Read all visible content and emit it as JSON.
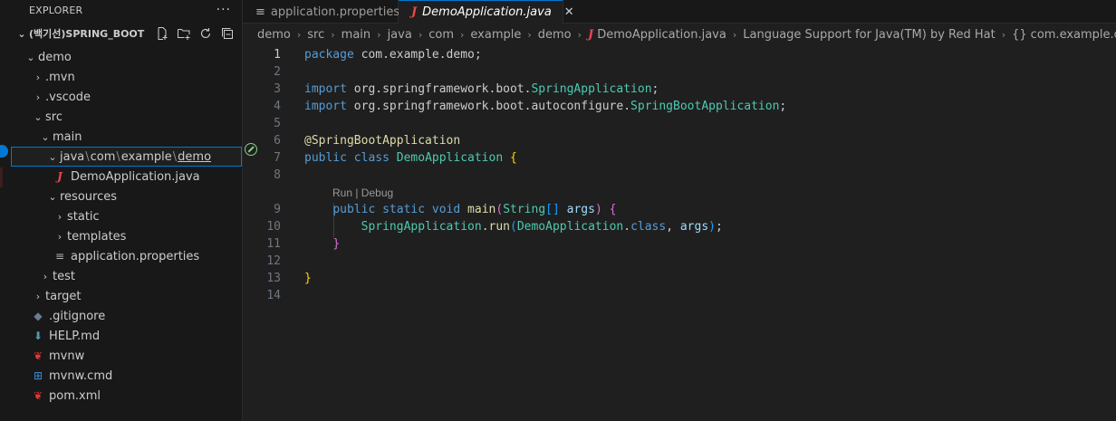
{
  "explorer": {
    "title": "EXPLORER",
    "more": "···",
    "root_label": "(백기선)SPRING_BOOT",
    "actions": [
      "new-file-icon",
      "new-folder-icon",
      "refresh-icon",
      "collapse-all-icon"
    ]
  },
  "tree": {
    "demo": "demo",
    "mvn": ".mvn",
    "vscode": ".vscode",
    "src": "src",
    "main": "main",
    "pkg": {
      "p1": "java",
      "p2": "com",
      "p3": "example",
      "p4": "demo",
      "sep": "\\"
    },
    "demo_app": "DemoApplication.java",
    "resources": "resources",
    "static": "static",
    "templates": "templates",
    "app_props": "application.properties",
    "test": "test",
    "target": "target",
    "gitignore": ".gitignore",
    "help": "HELP.md",
    "mvnw": "mvnw",
    "mvnw_cmd": "mvnw.cmd",
    "pom": "pom.xml"
  },
  "tabs": [
    {
      "label": "application.properties",
      "icon": "properties-file-icon",
      "active": false
    },
    {
      "label": "DemoApplication.java",
      "icon": "java-file-icon",
      "active": true
    }
  ],
  "breadcrumb": {
    "items": [
      "demo",
      "src",
      "main",
      "java",
      "com",
      "example",
      "demo"
    ],
    "file": "DemoApplication.java",
    "lang": "Language Support for Java(TM) by Red Hat",
    "symbol": "com.example.demo"
  },
  "code": {
    "line_numbers": [
      "1",
      "2",
      "3",
      "4",
      "5",
      "6",
      "7",
      "8",
      "9",
      "10",
      "11",
      "12",
      "13",
      "14"
    ],
    "l1_kw": "package",
    "l1_rest": " com.example.demo;",
    "l3_kw": "import",
    "l3_pkg": " org.springframework.boot.",
    "l3_cls": "SpringApplication",
    "l3_end": ";",
    "l4_kw": "import",
    "l4_pkg": " org.springframework.boot.autoconfigure.",
    "l4_cls": "SpringBootApplication",
    "l4_end": ";",
    "l6_ann": "@SpringBootApplication",
    "l7_kw1": "public",
    "l7_kw2": "class",
    "l7_cls": "DemoApplication",
    "l7_br": "{",
    "codelens": "Run | Debug",
    "l9_kw1": "public",
    "l9_kw2": "static",
    "l9_kw3": "void",
    "l9_fn": "main",
    "l9_p1": "(",
    "l9_ty": "String",
    "l9_arr": "[]",
    "l9_var": "args",
    "l9_p2": ")",
    "l9_br": "{",
    "l10_ty": "SpringApplication",
    "l10_dot": ".",
    "l10_fn": "run",
    "l10_p1": "(",
    "l10_cls": "DemoApplication",
    "l10_dot2": ".",
    "l10_kw": "class",
    "l10_comma": ", ",
    "l10_var": "args",
    "l10_p2": ")",
    "l10_end": ";",
    "l11_br": "}",
    "l13_br": "}"
  }
}
